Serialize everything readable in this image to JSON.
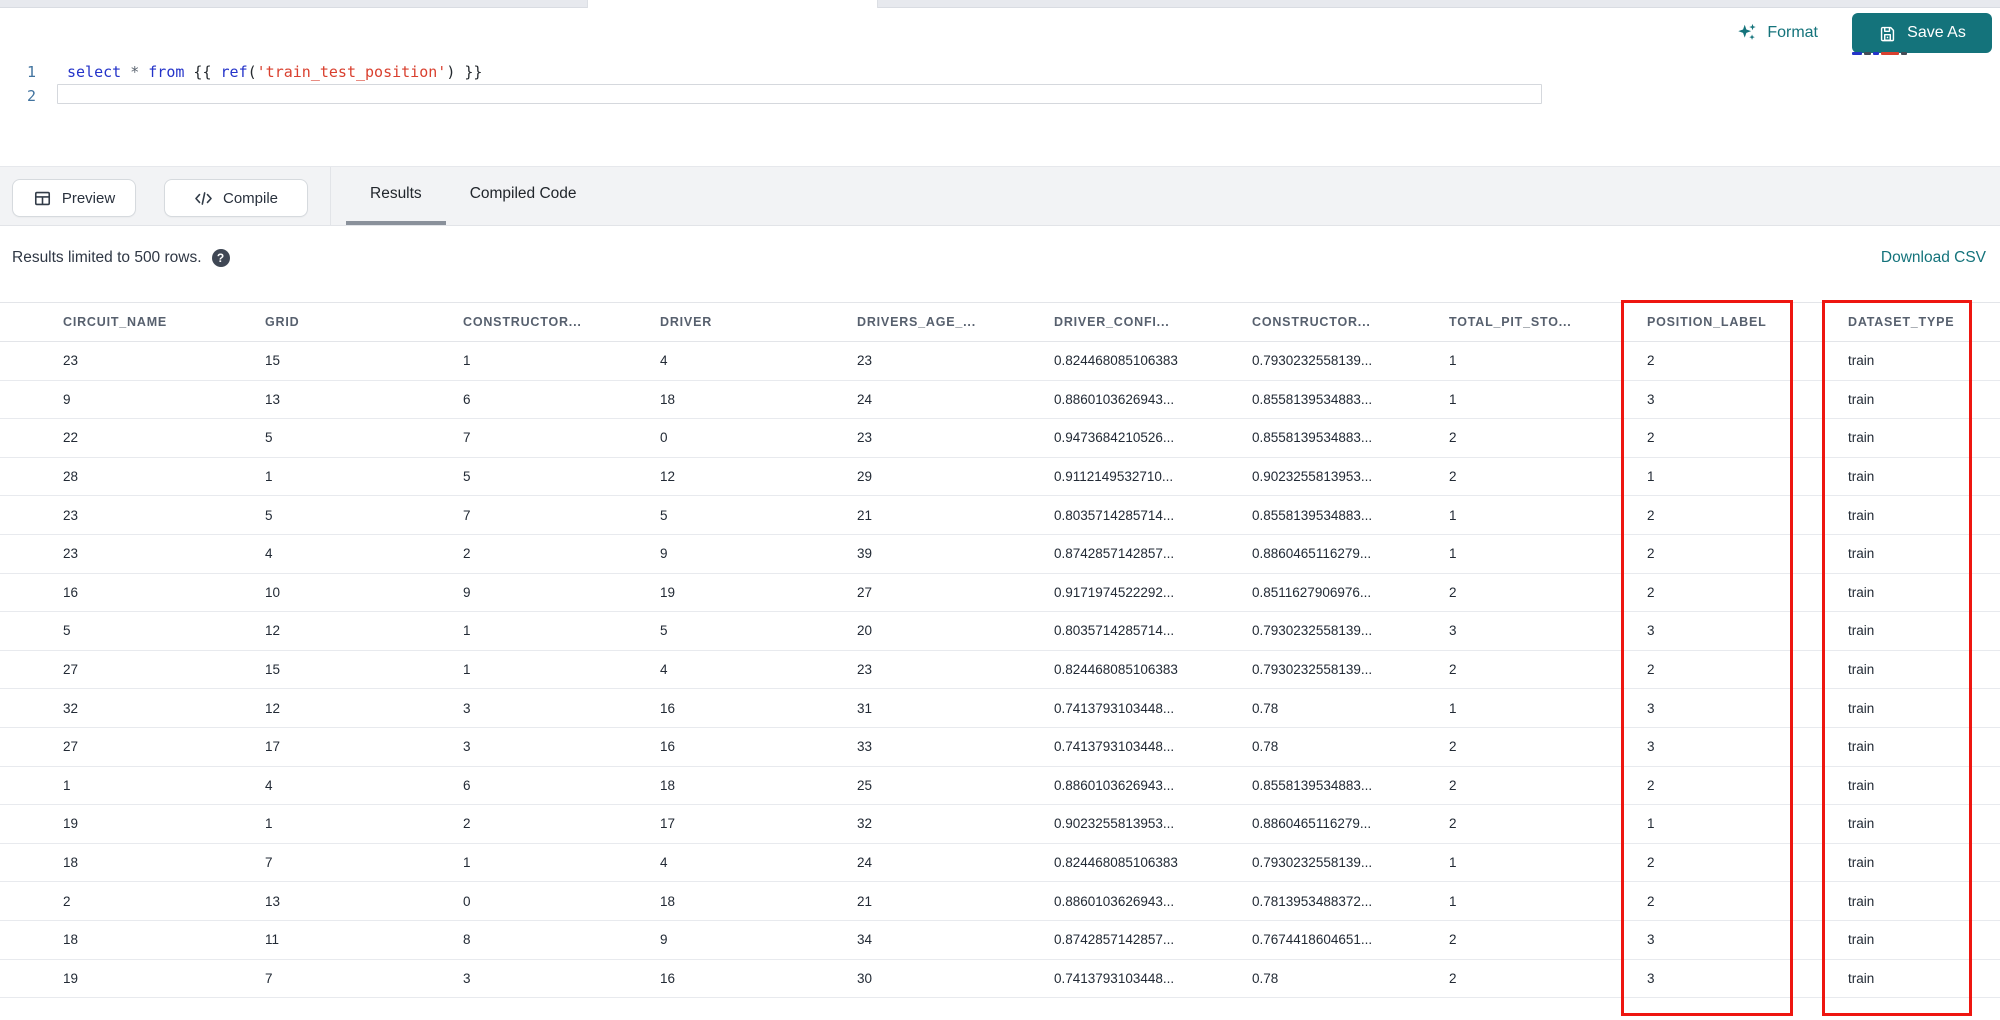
{
  "editor": {
    "line_numbers": [
      "1",
      "2"
    ],
    "code_text": "select * from {{ ref('train_test_position') }}",
    "tokens": [
      {
        "text": "select",
        "type": "keyword"
      },
      {
        "text": " ",
        "type": "plain"
      },
      {
        "text": "*",
        "type": "operator"
      },
      {
        "text": " ",
        "type": "plain"
      },
      {
        "text": "from",
        "type": "keyword"
      },
      {
        "text": " {{ ",
        "type": "plain"
      },
      {
        "text": "ref",
        "type": "keyword"
      },
      {
        "text": "(",
        "type": "plain"
      },
      {
        "text": "'train_test_position'",
        "type": "string"
      },
      {
        "text": ") }}",
        "type": "plain"
      }
    ]
  },
  "toolbar": {
    "format_label": "Format",
    "save_as_label": "Save As",
    "preview_label": "Preview",
    "compile_label": "Compile"
  },
  "tabs": [
    {
      "label": "Results",
      "active": true
    },
    {
      "label": "Compiled Code",
      "active": false
    }
  ],
  "results_bar": {
    "info": "Results limited to 500 rows.",
    "help_glyph": "?",
    "download_label": "Download CSV"
  },
  "table": {
    "columns": [
      "CIRCUIT_NAME",
      "GRID",
      "CONSTRUCTOR...",
      "DRIVER",
      "DRIVERS_AGE_...",
      "DRIVER_CONFI...",
      "CONSTRUCTOR...",
      "TOTAL_PIT_STO...",
      "POSITION_LABEL",
      "DATASET_TYPE"
    ],
    "highlighted_columns": [
      "POSITION_LABEL",
      "DATASET_TYPE"
    ],
    "rows": [
      [
        "23",
        "15",
        "1",
        "4",
        "23",
        "0.824468085106383",
        "0.7930232558139...",
        "1",
        "2",
        "train"
      ],
      [
        "9",
        "13",
        "6",
        "18",
        "24",
        "0.8860103626943...",
        "0.8558139534883...",
        "1",
        "3",
        "train"
      ],
      [
        "22",
        "5",
        "7",
        "0",
        "23",
        "0.9473684210526...",
        "0.8558139534883...",
        "2",
        "2",
        "train"
      ],
      [
        "28",
        "1",
        "5",
        "12",
        "29",
        "0.9112149532710...",
        "0.9023255813953...",
        "2",
        "1",
        "train"
      ],
      [
        "23",
        "5",
        "7",
        "5",
        "21",
        "0.8035714285714...",
        "0.8558139534883...",
        "1",
        "2",
        "train"
      ],
      [
        "23",
        "4",
        "2",
        "9",
        "39",
        "0.8742857142857...",
        "0.8860465116279...",
        "1",
        "2",
        "train"
      ],
      [
        "16",
        "10",
        "9",
        "19",
        "27",
        "0.9171974522292...",
        "0.8511627906976...",
        "2",
        "2",
        "train"
      ],
      [
        "5",
        "12",
        "1",
        "5",
        "20",
        "0.8035714285714...",
        "0.7930232558139...",
        "3",
        "3",
        "train"
      ],
      [
        "27",
        "15",
        "1",
        "4",
        "23",
        "0.824468085106383",
        "0.7930232558139...",
        "2",
        "2",
        "train"
      ],
      [
        "32",
        "12",
        "3",
        "16",
        "31",
        "0.7413793103448...",
        "0.78",
        "1",
        "3",
        "train"
      ],
      [
        "27",
        "17",
        "3",
        "16",
        "33",
        "0.7413793103448...",
        "0.78",
        "2",
        "3",
        "train"
      ],
      [
        "1",
        "4",
        "6",
        "18",
        "25",
        "0.8860103626943...",
        "0.8558139534883...",
        "2",
        "2",
        "train"
      ],
      [
        "19",
        "1",
        "2",
        "17",
        "32",
        "0.9023255813953...",
        "0.8860465116279...",
        "2",
        "1",
        "train"
      ],
      [
        "18",
        "7",
        "1",
        "4",
        "24",
        "0.824468085106383",
        "0.7930232558139...",
        "1",
        "2",
        "train"
      ],
      [
        "2",
        "13",
        "0",
        "18",
        "21",
        "0.8860103626943...",
        "0.7813953488372...",
        "1",
        "2",
        "train"
      ],
      [
        "18",
        "11",
        "8",
        "9",
        "34",
        "0.8742857142857...",
        "0.7674418604651...",
        "2",
        "3",
        "train"
      ],
      [
        "19",
        "7",
        "3",
        "16",
        "30",
        "0.7413793103448...",
        "0.78",
        "2",
        "3",
        "train"
      ]
    ]
  },
  "colors": {
    "accent_teal": "#14737b",
    "highlight_red": "#ee1610",
    "code_keyword_blue": "#2433c9",
    "code_string_red": "#d9402f"
  }
}
